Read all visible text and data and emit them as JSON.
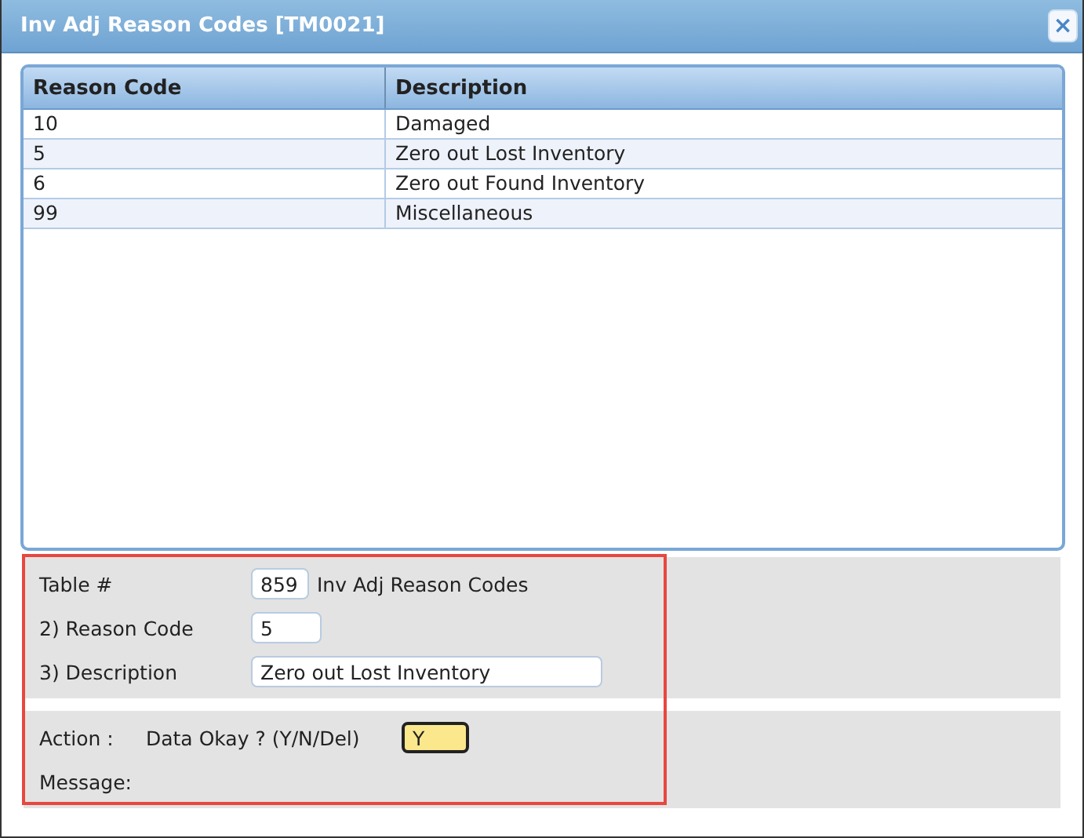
{
  "window": {
    "title": "Inv Adj Reason Codes [TM0021]",
    "close": "×"
  },
  "table": {
    "columns": [
      "Reason Code",
      "Description"
    ],
    "rows": [
      [
        "10",
        "Damaged"
      ],
      [
        "5",
        "Zero out Lost Inventory"
      ],
      [
        "6",
        "Zero out Found Inventory"
      ],
      [
        "99",
        "Miscellaneous"
      ]
    ]
  },
  "form": {
    "fields": [
      {
        "label": "Table #",
        "value": "859",
        "note": "Inv Adj Reason Codes"
      },
      {
        "label": "2) Reason Code",
        "value": "5"
      },
      {
        "label": "3) Description",
        "value": "Zero out Lost Inventory"
      }
    ]
  },
  "action": {
    "label": "Action :",
    "prompt": "Data Okay ? (Y/N/Del)",
    "value": "Y",
    "message_label": "Message:"
  }
}
